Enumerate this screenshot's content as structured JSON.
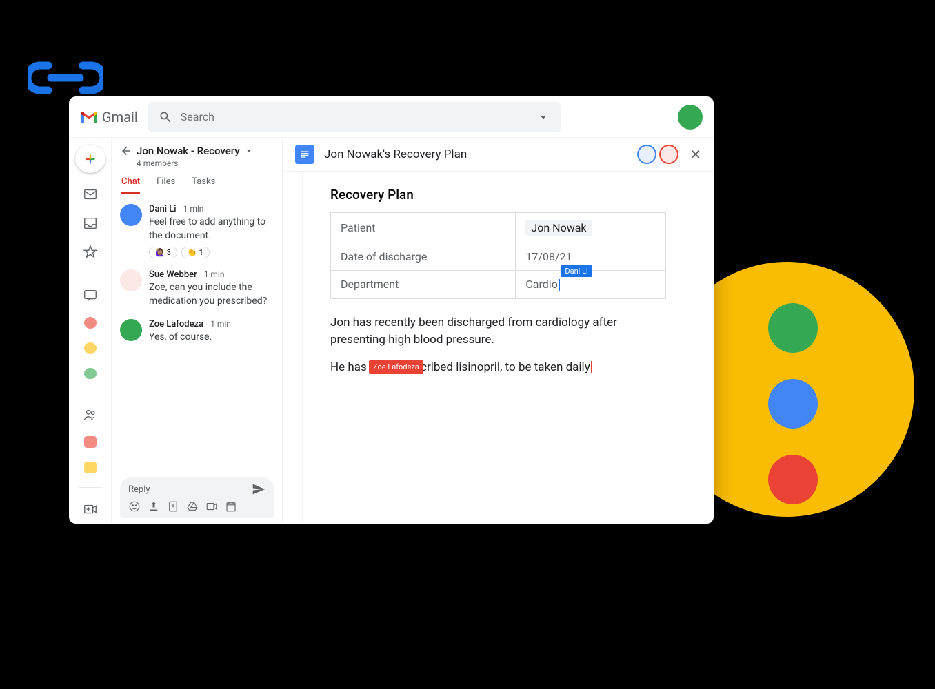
{
  "app": {
    "name": "Gmail"
  },
  "search": {
    "placeholder": "Search"
  },
  "chat": {
    "title": "Jon Nowak - Recovery",
    "members": "4 members",
    "tabs": [
      {
        "label": "Chat",
        "active": true
      },
      {
        "label": "Files",
        "active": false
      },
      {
        "label": "Tasks",
        "active": false
      }
    ],
    "messages": [
      {
        "author": "Dani Li",
        "time": "1 min",
        "text": "Feel free to add anything to the document.",
        "avatar_color": "#4285f4",
        "reactions": [
          {
            "emoji": "🙋🏽‍♀️",
            "count": "3"
          },
          {
            "emoji": "👏",
            "count": "1"
          }
        ]
      },
      {
        "author": "Sue Webber",
        "time": "1 min",
        "text": "Zoe, can you include the medication you prescribed?",
        "avatar_color": "#fce8e6"
      },
      {
        "author": "Zoe Lafodeza",
        "time": "1 min",
        "text": "Yes, of course.",
        "avatar_color": "#34a853"
      }
    ],
    "reply_placeholder": "Reply"
  },
  "doc": {
    "title": "Jon Nowak's Recovery Plan",
    "heading": "Recovery Plan",
    "table": [
      {
        "label": "Patient",
        "value": "Jon Nowak",
        "highlight": true
      },
      {
        "label": "Date of discharge",
        "value": "17/08/21"
      },
      {
        "label": "Department",
        "value": "Cardio",
        "cursor_tag": "Dani Li",
        "cursor_color": "blue"
      }
    ],
    "paragraphs": [
      {
        "text": "Jon has recently been discharged from cardiology after presenting high blood pressure."
      },
      {
        "text_before": "He has been prescribed lisinopril, to be taken daily",
        "cursor_tag": "Zoe Lafodeza",
        "cursor_color": "red"
      }
    ],
    "collaborators": [
      {
        "border": "#4285f4"
      },
      {
        "border": "#ea4335"
      }
    ]
  }
}
